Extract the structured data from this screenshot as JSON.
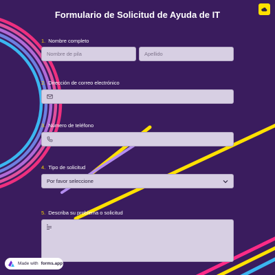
{
  "form": {
    "title": "Formulario de Solicitud de Ayuda de IT"
  },
  "questions": [
    {
      "number": "1.",
      "label": "Nombre completo",
      "first_placeholder": "Nombre de pila",
      "last_placeholder": "Apellido"
    },
    {
      "number": "2.",
      "label": "Dirección de correo electrónico",
      "icon": "mail-icon"
    },
    {
      "number": "3.",
      "label": "Número de teléfono",
      "icon": "phone-icon"
    },
    {
      "number": "4.",
      "label": "Tipo de solicitud",
      "selected": "Por favor seleccione"
    },
    {
      "number": "5.",
      "label": "Describa su problema o solicitud",
      "icon": "text-lines-icon"
    }
  ],
  "branding": {
    "made_with": "Made with",
    "brand": "forms.app"
  },
  "colors": {
    "background": "#3a1c5e",
    "accent_yellow": "#ffe100",
    "field_bg": "#d7cfe3"
  }
}
